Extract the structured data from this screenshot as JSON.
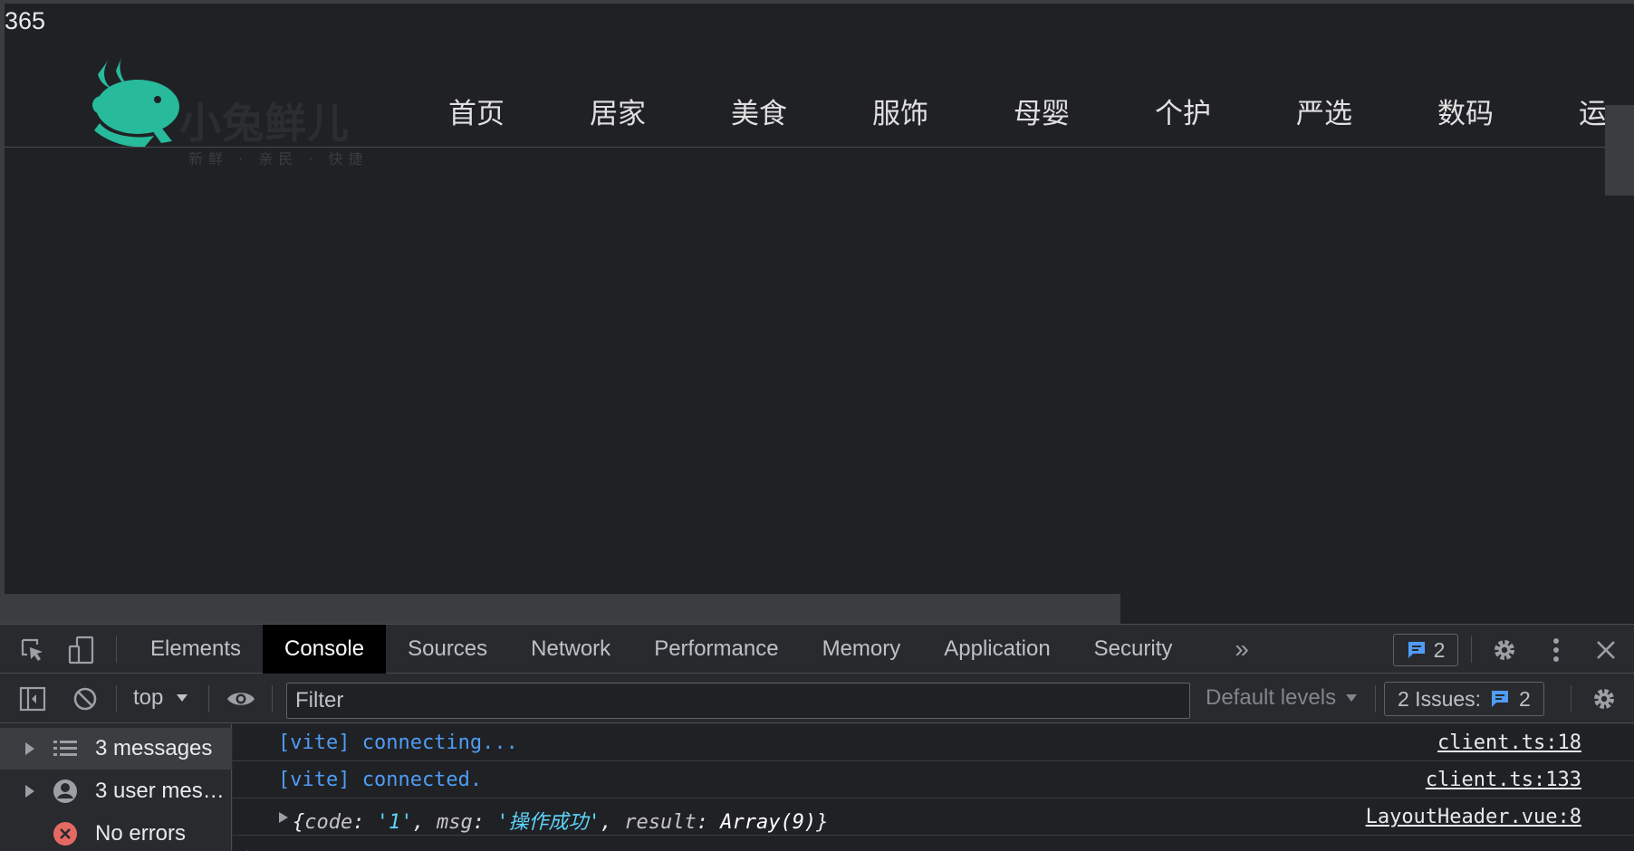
{
  "page": {
    "counter": "365",
    "logo": {
      "text": "小兔鲜儿",
      "slogan": "新鲜 · 亲民 · 快捷",
      "brand_color": "#27ba9b"
    },
    "nav": [
      "首页",
      "居家",
      "美食",
      "服饰",
      "母婴",
      "个护",
      "严选",
      "数码",
      "运"
    ]
  },
  "devtools": {
    "tabs": [
      {
        "label": "Elements",
        "active": false
      },
      {
        "label": "Console",
        "active": true
      },
      {
        "label": "Sources",
        "active": false
      },
      {
        "label": "Network",
        "active": false
      },
      {
        "label": "Performance",
        "active": false
      },
      {
        "label": "Memory",
        "active": false
      },
      {
        "label": "Application",
        "active": false
      },
      {
        "label": "Security",
        "active": false
      }
    ],
    "more_tabs": "»",
    "issues_badge_count": "2",
    "toolbar": {
      "context": "top",
      "filter_placeholder": "Filter",
      "levels": "Default levels",
      "issues_label": "2 Issues:",
      "issues_count": "2"
    },
    "sidebar": [
      {
        "label": "3 messages",
        "icon": "list-icon",
        "selected": true
      },
      {
        "label": "3 user mes…",
        "icon": "user-icon",
        "selected": false
      },
      {
        "label": "No errors",
        "icon": "error-icon",
        "selected": false
      }
    ],
    "messages": [
      {
        "text": "[vite] connecting...",
        "source": "client.ts:18"
      },
      {
        "text": "[vite] connected.",
        "source": "client.ts:133"
      },
      {
        "object": {
          "open": "{",
          "code_key": "code",
          "code_val": "'1'",
          "msg_key": "msg",
          "msg_val": "'操作成功'",
          "result_key": "result",
          "result_val": "Array(9)",
          "close": "}"
        },
        "source": "LayoutHeader.vue:8"
      }
    ],
    "prompt": "›",
    "accent_color": "#4f9cf6"
  }
}
